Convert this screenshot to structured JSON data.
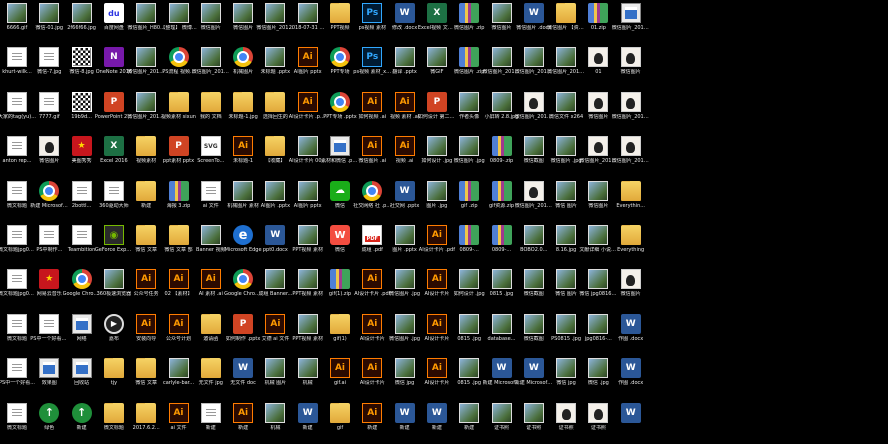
{
  "desktop": {
    "columns": [
      [
        {
          "label": "6666.gif",
          "icon": "photo"
        },
        {
          "label": "khurt-wilk...",
          "icon": "doc"
        },
        {
          "label": "大家的tag(yu)...",
          "icon": "doc"
        },
        {
          "label": "anton rep...",
          "icon": "doc"
        },
        {
          "label": "微文标题",
          "icon": "doc"
        },
        {
          "label": "微文标题jpg0815-...",
          "icon": "doc"
        },
        {
          "label": "微文标题jpg0815-...",
          "icon": "doc"
        },
        {
          "label": "微文标题",
          "icon": "doc"
        },
        {
          "label": "PS中一个好看...",
          "icon": "doc"
        },
        {
          "label": "微文标题",
          "icon": "doc"
        }
      ],
      [
        {
          "label": "微信-01.jpg",
          "icon": "photo"
        },
        {
          "label": "微信-7.jpg",
          "icon": "doc"
        },
        {
          "label": "7777.gif",
          "icon": "doc"
        },
        {
          "label": "微信图片",
          "icon": "avatar"
        },
        {
          "label": "新建 Microsoft...",
          "icon": "chrome"
        },
        {
          "label": "PS中制作...",
          "icon": "doc"
        },
        {
          "label": "网易云音乐",
          "icon": "red"
        },
        {
          "label": "PS中一个好看的...",
          "icon": "doc"
        },
        {
          "label": "效果图",
          "icon": "exe"
        },
        {
          "label": "绿色",
          "icon": "green"
        }
      ],
      [
        {
          "label": "2f66f66.jpg",
          "icon": "photo"
        },
        {
          "label": "微信-8.jpg",
          "icon": "qr"
        },
        {
          "label": "19b9d...",
          "icon": "qr"
        },
        {
          "label": "美图秀秀",
          "icon": "red"
        },
        {
          "label": "2bottl...",
          "icon": "doc"
        },
        {
          "label": "Teambition",
          "icon": "doc"
        },
        {
          "label": "Google Chrome",
          "icon": "chrome"
        },
        {
          "label": "网络",
          "icon": "exe"
        },
        {
          "label": "回收站",
          "icon": "exe"
        },
        {
          "label": "新建",
          "icon": "green"
        }
      ],
      [
        {
          "label": "百度网盘",
          "icon": "baidu"
        },
        {
          "label": "OneNote 2016",
          "icon": "onenote"
        },
        {
          "label": "PowerPoint 2016",
          "icon": "ppt"
        },
        {
          "label": "Excel 2016",
          "icon": "xls"
        },
        {
          "label": "360驱动大师",
          "icon": "doc"
        },
        {
          "label": "GeForce Experience",
          "icon": "nvidia"
        },
        {
          "label": "360极速浏览器",
          "icon": "photo"
        },
        {
          "label": "嘉布",
          "icon": "media"
        },
        {
          "label": "tjy",
          "icon": "folder"
        },
        {
          "label": "微文标题",
          "icon": "folder"
        }
      ],
      [
        {
          "label": "微信图片_H80...",
          "icon": "photo"
        },
        {
          "label": "微信图片_2018...",
          "icon": "photo"
        },
        {
          "label": "微信图片_2018...",
          "icon": "photo"
        },
        {
          "label": "视频素材",
          "icon": "folder"
        },
        {
          "label": "新建",
          "icon": "folder"
        },
        {
          "label": "微信 文章",
          "icon": "folder"
        },
        {
          "label": "公众号任务",
          "icon": "ai"
        },
        {
          "label": "安装向导",
          "icon": "ai"
        },
        {
          "label": "微信 文章",
          "icon": "folder"
        },
        {
          "label": "2017.6.2...",
          "icon": "folder"
        }
      ],
      [
        {
          "label": "【整理】 微博...",
          "icon": "photo"
        },
        {
          "label": "PS流程 视频...",
          "icon": "chrome"
        },
        {
          "label": "视频素材 sixun",
          "icon": "folder"
        },
        {
          "label": "ppt素材 pptx",
          "icon": "ppt"
        },
        {
          "label": "海报 3.zip",
          "icon": "zip"
        },
        {
          "label": "微信 文章 部",
          "icon": "folder"
        },
        {
          "label": "02 【素材】",
          "icon": "ai"
        },
        {
          "label": "公众号计划",
          "icon": "ai"
        },
        {
          "label": "carlyle-bar...",
          "icon": "photo"
        },
        {
          "label": "ai 文件",
          "icon": "ai"
        }
      ],
      [
        {
          "label": "微信图片",
          "icon": "photo"
        },
        {
          "label": "微信图片_2018...",
          "icon": "photo"
        },
        {
          "label": "我的 文档",
          "icon": "folder"
        },
        {
          "label": "ScreenTo...",
          "icon": "svg"
        },
        {
          "label": "ai 文件",
          "icon": "doc"
        },
        {
          "label": "Banner 视频",
          "icon": "photo"
        },
        {
          "label": "AI 素材 .ai",
          "icon": "ai"
        },
        {
          "label": "邀请函",
          "icon": "folder"
        },
        {
          "label": "无文件 jpg",
          "icon": "folder"
        },
        {
          "label": "新建",
          "icon": "doc"
        }
      ],
      [
        {
          "label": "微信图片",
          "icon": "photo"
        },
        {
          "label": "机械图片",
          "icon": "chrome"
        },
        {
          "label": "未标题-1.jpg",
          "icon": "folder"
        },
        {
          "label": "未标题-1",
          "icon": "ai"
        },
        {
          "label": "机械图片 素材",
          "icon": "photo"
        },
        {
          "label": "Microsoft Edge",
          "icon": "edge"
        },
        {
          "label": "Google Chrome",
          "icon": "chrome"
        },
        {
          "label": "如何制作 .pptx",
          "icon": "ppt"
        },
        {
          "label": "无文件 doc",
          "icon": "word"
        },
        {
          "label": "新建",
          "icon": "ai"
        }
      ],
      [
        {
          "label": "微信图片_2018...",
          "icon": "photo"
        },
        {
          "label": "未标题 .pptx",
          "icon": "photo"
        },
        {
          "label": "选择回生的",
          "icon": "folder"
        },
        {
          "label": "【收藏】",
          "icon": "folder"
        },
        {
          "label": "AI图片 .pptx",
          "icon": "photo"
        },
        {
          "label": "ppt0.docx",
          "icon": "word"
        },
        {
          "label": "成组 Banner...",
          "icon": "photo"
        },
        {
          "label": "艾德 ai 文件",
          "icon": "ai"
        },
        {
          "label": "机械 图片",
          "icon": "photo"
        },
        {
          "label": "机械",
          "icon": "photo"
        }
      ],
      [
        {
          "label": "2018-07-31 11 目录",
          "icon": "photo"
        },
        {
          "label": "AI图片 pptx",
          "icon": "ai"
        },
        {
          "label": "AI设计卡片 .pptx",
          "icon": "ai"
        },
        {
          "label": "AI设计卡片 0004.jpg",
          "icon": "photo"
        },
        {
          "label": "AI图片 pptx",
          "icon": "photo"
        },
        {
          "label": "PPT视频 素材",
          "icon": "photo"
        },
        {
          "label": "PPT视频 素材",
          "icon": "photo"
        },
        {
          "label": "PPT视频 素材",
          "icon": "photo"
        },
        {
          "label": "机械",
          "icon": "photo"
        },
        {
          "label": "新建",
          "icon": "word"
        }
      ],
      [
        {
          "label": "PPT视频",
          "icon": "folder"
        },
        {
          "label": "PPT专场",
          "icon": "chrome"
        },
        {
          "label": "PPT专场 .pptx",
          "icon": "chrome"
        },
        {
          "label": "素材和微信 .pptx",
          "icon": "exe"
        },
        {
          "label": "微信",
          "icon": "wechat"
        },
        {
          "label": "微信",
          "icon": "wps"
        },
        {
          "label": "gif(1).zip",
          "icon": "zip"
        },
        {
          "label": "gif(1)",
          "icon": "folder"
        },
        {
          "label": "gif.ai",
          "icon": "ai"
        },
        {
          "label": "gif",
          "icon": "folder"
        }
      ],
      [
        {
          "label": "ps视频 素材",
          "icon": "ps"
        },
        {
          "label": "ps视频 素材_x264",
          "icon": "ps"
        },
        {
          "label": "如何视频 .ai",
          "icon": "ai"
        },
        {
          "label": "微信图片 .ai",
          "icon": "ai"
        },
        {
          "label": "社交网络 社 .pptx",
          "icon": "chrome"
        },
        {
          "label": "成组 .pdf",
          "icon": "pdf"
        },
        {
          "label": "AI设计卡片 .pdf",
          "icon": "ai"
        },
        {
          "label": "AI设计卡片",
          "icon": "ai"
        },
        {
          "label": "AI设计卡片",
          "icon": "ai"
        },
        {
          "label": "新建",
          "icon": "ai"
        }
      ],
      [
        {
          "label": "修改 .docx",
          "icon": "word"
        },
        {
          "label": "翻译 .pptx",
          "icon": "photo"
        },
        {
          "label": "视频 素材 .ai",
          "icon": "ai"
        },
        {
          "label": "视频 .ai",
          "icon": "ai"
        },
        {
          "label": "社交网 .pptx",
          "icon": "word"
        },
        {
          "label": "图片 .pptx",
          "icon": "photo"
        },
        {
          "label": "微信图片 .jpg",
          "icon": "photo"
        },
        {
          "label": "微信图片 .jpg",
          "icon": "photo"
        },
        {
          "label": "微信 jpg",
          "icon": "photo"
        },
        {
          "label": "新建",
          "icon": "word"
        }
      ],
      [
        {
          "label": "Excel视频 文案(1)",
          "icon": "xls"
        },
        {
          "label": "微GIF",
          "icon": "photo"
        },
        {
          "label": "如何设计 第二期.pptx",
          "icon": "ppt"
        },
        {
          "label": "如何设计 .jpg",
          "icon": "photo"
        },
        {
          "label": "图片 .jpg",
          "icon": "photo"
        },
        {
          "label": "AI设计卡片 .pdf",
          "icon": "ai"
        },
        {
          "label": "AI设计卡片",
          "icon": "ai"
        },
        {
          "label": "AI设计卡片",
          "icon": "ai"
        },
        {
          "label": "AI设计卡片",
          "icon": "ai"
        },
        {
          "label": "新建",
          "icon": "word"
        }
      ],
      [
        {
          "label": "微信图片 .zip",
          "icon": "zip"
        },
        {
          "label": "微信图片 .zip",
          "icon": "zip"
        },
        {
          "label": "作者头像",
          "icon": "photo"
        },
        {
          "label": "微信图片 .jpg",
          "icon": "photo"
        },
        {
          "label": "gif .zip",
          "icon": "zip"
        },
        {
          "label": "0809-...",
          "icon": "zip"
        },
        {
          "label": "如何设计 .jpg",
          "icon": "photo"
        },
        {
          "label": "0815 .jpg",
          "icon": "photo"
        },
        {
          "label": "0815 .jpg",
          "icon": "photo"
        },
        {
          "label": "新建",
          "icon": "photo"
        }
      ],
      [
        {
          "label": "微信图片",
          "icon": "photo"
        },
        {
          "label": "微信图片_2018...",
          "icon": "photo"
        },
        {
          "label": "小屏转 2.8.jpg",
          "icon": "photo"
        },
        {
          "label": "0809-.zip",
          "icon": "zip"
        },
        {
          "label": "gif资源.zip",
          "icon": "zip"
        },
        {
          "label": "0809-...",
          "icon": "zip"
        },
        {
          "label": "0815 .jpg",
          "icon": "photo"
        },
        {
          "label": "database...",
          "icon": "photo"
        },
        {
          "label": "新建 Microsoft...",
          "icon": "word"
        },
        {
          "label": "证书照",
          "icon": "photo"
        }
      ],
      [
        {
          "label": "微信图片 .docx",
          "icon": "word"
        },
        {
          "label": "微信图片_2018...",
          "icon": "photo"
        },
        {
          "label": "微信图片_2018...",
          "icon": "avatar"
        },
        {
          "label": "微信截图",
          "icon": "photo"
        },
        {
          "label": "微信图片_2018...",
          "icon": "avatar"
        },
        {
          "label": "BOBO2.0...",
          "icon": "photo"
        },
        {
          "label": "微信截图",
          "icon": "photo"
        },
        {
          "label": "微信截图",
          "icon": "photo"
        },
        {
          "label": "新建 Microsoft...",
          "icon": "word"
        },
        {
          "label": "证书照",
          "icon": "photo"
        }
      ],
      [
        {
          "label": "微信图片 【资源】 PS)",
          "icon": "folder"
        },
        {
          "label": "微信图片_2018...",
          "icon": "photo"
        },
        {
          "label": "微信文件 x264",
          "icon": "photo"
        },
        {
          "label": "微信图片 .jpg",
          "icon": "photo"
        },
        {
          "label": "微信 图片",
          "icon": "photo"
        },
        {
          "label": "8.16.jpg",
          "icon": "photo"
        },
        {
          "label": "微信 图片",
          "icon": "photo"
        },
        {
          "label": "PS0815 .jpg",
          "icon": "photo"
        },
        {
          "label": "微信 jpg",
          "icon": "photo"
        },
        {
          "label": "证书照",
          "icon": "avatar"
        }
      ],
      [
        {
          "label": "01.zip",
          "icon": "zip"
        },
        {
          "label": "01",
          "icon": "avatar"
        },
        {
          "label": "微信图片",
          "icon": "avatar"
        },
        {
          "label": "微信图片_2018...",
          "icon": "avatar"
        },
        {
          "label": "微信图片",
          "icon": "photo"
        },
        {
          "label": "文献详细 小说.x264",
          "icon": "photo"
        },
        {
          "label": "微信 jpg0816-...",
          "icon": "photo"
        },
        {
          "label": "jpg0816-...",
          "icon": "photo"
        },
        {
          "label": "微信 .jpg",
          "icon": "photo"
        },
        {
          "label": "证书照",
          "icon": "avatar"
        }
      ],
      [
        {
          "label": "微信图片_2018...",
          "icon": "exe"
        },
        {
          "label": "微信图片",
          "icon": "avatar"
        },
        {
          "label": "微信图片_2018...",
          "icon": "avatar"
        },
        {
          "label": "微信图片_2018...",
          "icon": "avatar"
        },
        {
          "label": "Everythin...",
          "icon": "folder"
        },
        {
          "label": "Everything",
          "icon": "folder"
        },
        {
          "label": "微信图片",
          "icon": "avatar"
        },
        {
          "label": "作图 .docx",
          "icon": "word"
        },
        {
          "label": "作图 .docx",
          "icon": "word"
        },
        {
          "label": "",
          "icon": "word"
        }
      ]
    ]
  }
}
